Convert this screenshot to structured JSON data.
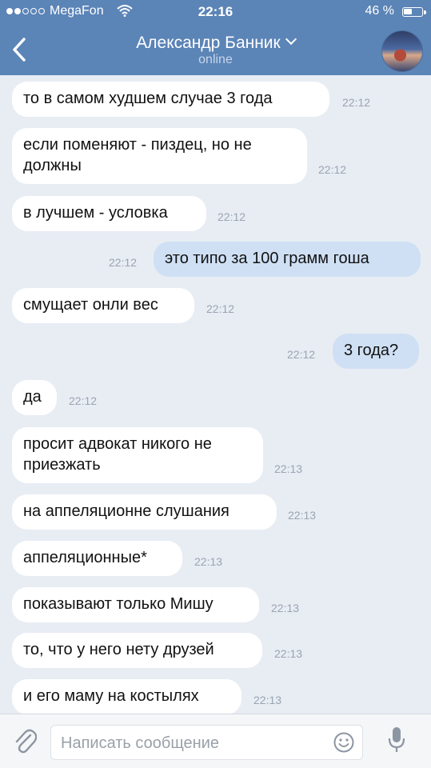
{
  "status_bar": {
    "carrier": "MegaFon",
    "time": "22:16",
    "battery_percent": "46 %",
    "battery_level": 0.46
  },
  "header": {
    "contact_name": "Александр Банник",
    "status": "online",
    "icons": {
      "back": "chevron-left-icon",
      "dropdown": "chevron-down-icon",
      "avatar": "avatar"
    }
  },
  "messages": [
    {
      "text": "то в самом худшем случае 3 года",
      "time": "22:12",
      "direction": "in"
    },
    {
      "text": "если поменяют - пиздец, но не\nдолжны",
      "time": "22:12",
      "direction": "in"
    },
    {
      "text": "в лучшем - условка",
      "time": "22:12",
      "direction": "in"
    },
    {
      "text": "это типо за 100 грамм гоша",
      "time": "22:12",
      "direction": "out"
    },
    {
      "text": "смущает онли вес",
      "time": "22:12",
      "direction": "in"
    },
    {
      "text": "3 года?",
      "time": "22:12",
      "direction": "out"
    },
    {
      "text": "да",
      "time": "22:12",
      "direction": "in"
    },
    {
      "text": "просит адвокат никого не\nприезжать",
      "time": "22:13",
      "direction": "in"
    },
    {
      "text": "на аппеляционне слушания",
      "time": "22:13",
      "direction": "in"
    },
    {
      "text": "аппеляционные*",
      "time": "22:13",
      "direction": "in"
    },
    {
      "text": "показывают только Мишу",
      "time": "22:13",
      "direction": "in"
    },
    {
      "text": "то, что у него нету друзей",
      "time": "22:13",
      "direction": "in"
    },
    {
      "text": "и его маму на костылях",
      "time": "22:13",
      "direction": "in"
    }
  ],
  "input_bar": {
    "placeholder": "Написать сообщение",
    "value": "",
    "icons": {
      "attach": "paperclip-icon",
      "emoji": "smile-icon",
      "voice": "microphone-icon"
    }
  },
  "colors": {
    "header_bg": "#5b84b7",
    "chat_bg": "#e8edf4",
    "incoming_bubble": "#ffffff",
    "outgoing_bubble": "#cfe0f4",
    "time_text": "#9aa4b1"
  }
}
